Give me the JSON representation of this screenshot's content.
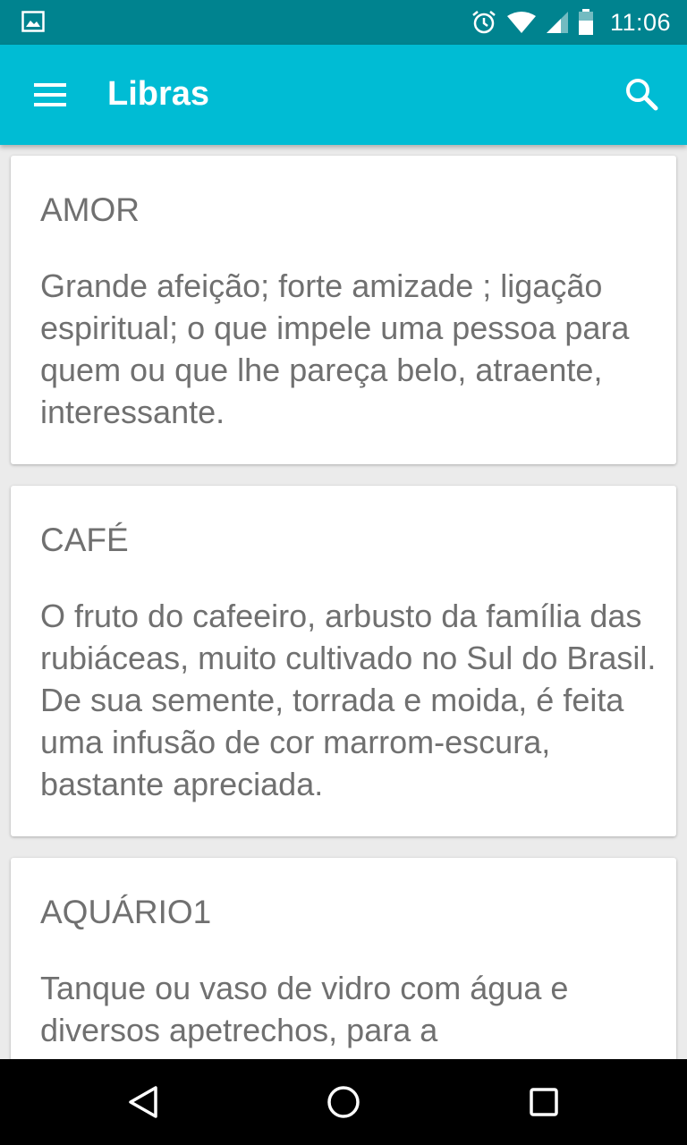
{
  "status_bar": {
    "time": "11:06",
    "icons": [
      "image-notification-icon",
      "alarm-icon",
      "wifi-icon",
      "cell-signal-icon",
      "battery-icon"
    ]
  },
  "app_bar": {
    "title": "Libras",
    "menu_icon": "hamburger-menu-icon",
    "search_icon": "search-icon"
  },
  "cards": [
    {
      "word": "AMOR",
      "definition": "Grande afeição; forte amizade ; ligação espiritual; o que impele uma pessoa para quem ou que lhe pareça belo, atraente, interessante."
    },
    {
      "word": "CAFÉ",
      "definition": "O fruto do cafeeiro, arbusto da família das rubiáceas, muito cultivado no Sul do Brasil. De sua semente, torrada e moida, é feita uma infusão de cor marrom-escura, bastante apreciada."
    },
    {
      "word": "AQUÁRIO1",
      "definition": "Tanque ou vaso de vidro com água e diversos apetrechos, para a"
    }
  ],
  "nav_bar": {
    "icons": [
      "back-icon",
      "home-icon",
      "recents-icon"
    ]
  },
  "colors": {
    "status_bar": "#00838f",
    "app_bar": "#00bcd4",
    "background": "#ebebeb",
    "card": "#ffffff",
    "text": "#707070",
    "nav_bar": "#000000"
  }
}
